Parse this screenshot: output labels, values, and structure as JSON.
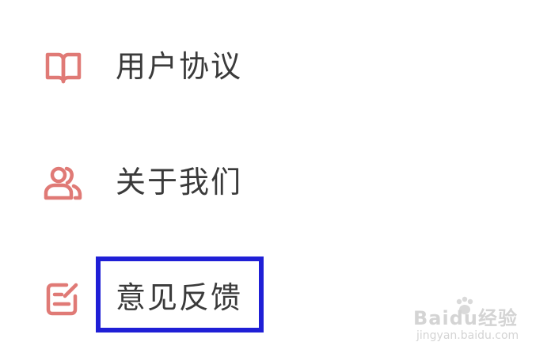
{
  "menu": {
    "items": [
      {
        "label": "用户协议",
        "icon": "book-icon"
      },
      {
        "label": "关于我们",
        "icon": "users-icon"
      },
      {
        "label": "意见反馈",
        "icon": "feedback-edit-icon"
      }
    ]
  },
  "watermark": {
    "brand": "Baidu经验",
    "url": "jingyan.baidu.com"
  },
  "colors": {
    "icon": "#e07a76",
    "text": "#3a3a3a",
    "highlight": "#1f1fd6"
  }
}
